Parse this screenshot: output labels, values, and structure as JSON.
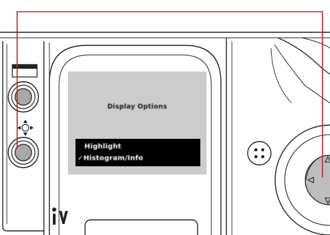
{
  "lcd": {
    "title": "Display Options",
    "menu_items": [
      {
        "label": "Highlight",
        "checked": false
      },
      {
        "label": "✓Histogram/Info",
        "checked": true
      }
    ],
    "menu_background": "#000000",
    "menu_text_color": "#ffffff",
    "screen_color": "#cccccc"
  },
  "controls": {
    "upper_button_icon": "display-bar-icon",
    "lower_button_icon": "four-way-arrows-icon",
    "review_button_icon": "review-delete-icon",
    "speaker_icon": "speaker-grille-icon",
    "dpad_arrows": [
      "up",
      "left",
      "down",
      "right"
    ]
  },
  "colors": {
    "callout_line": "#c62626",
    "body_line": "#222222",
    "button_fill": "#a8a8a8"
  }
}
